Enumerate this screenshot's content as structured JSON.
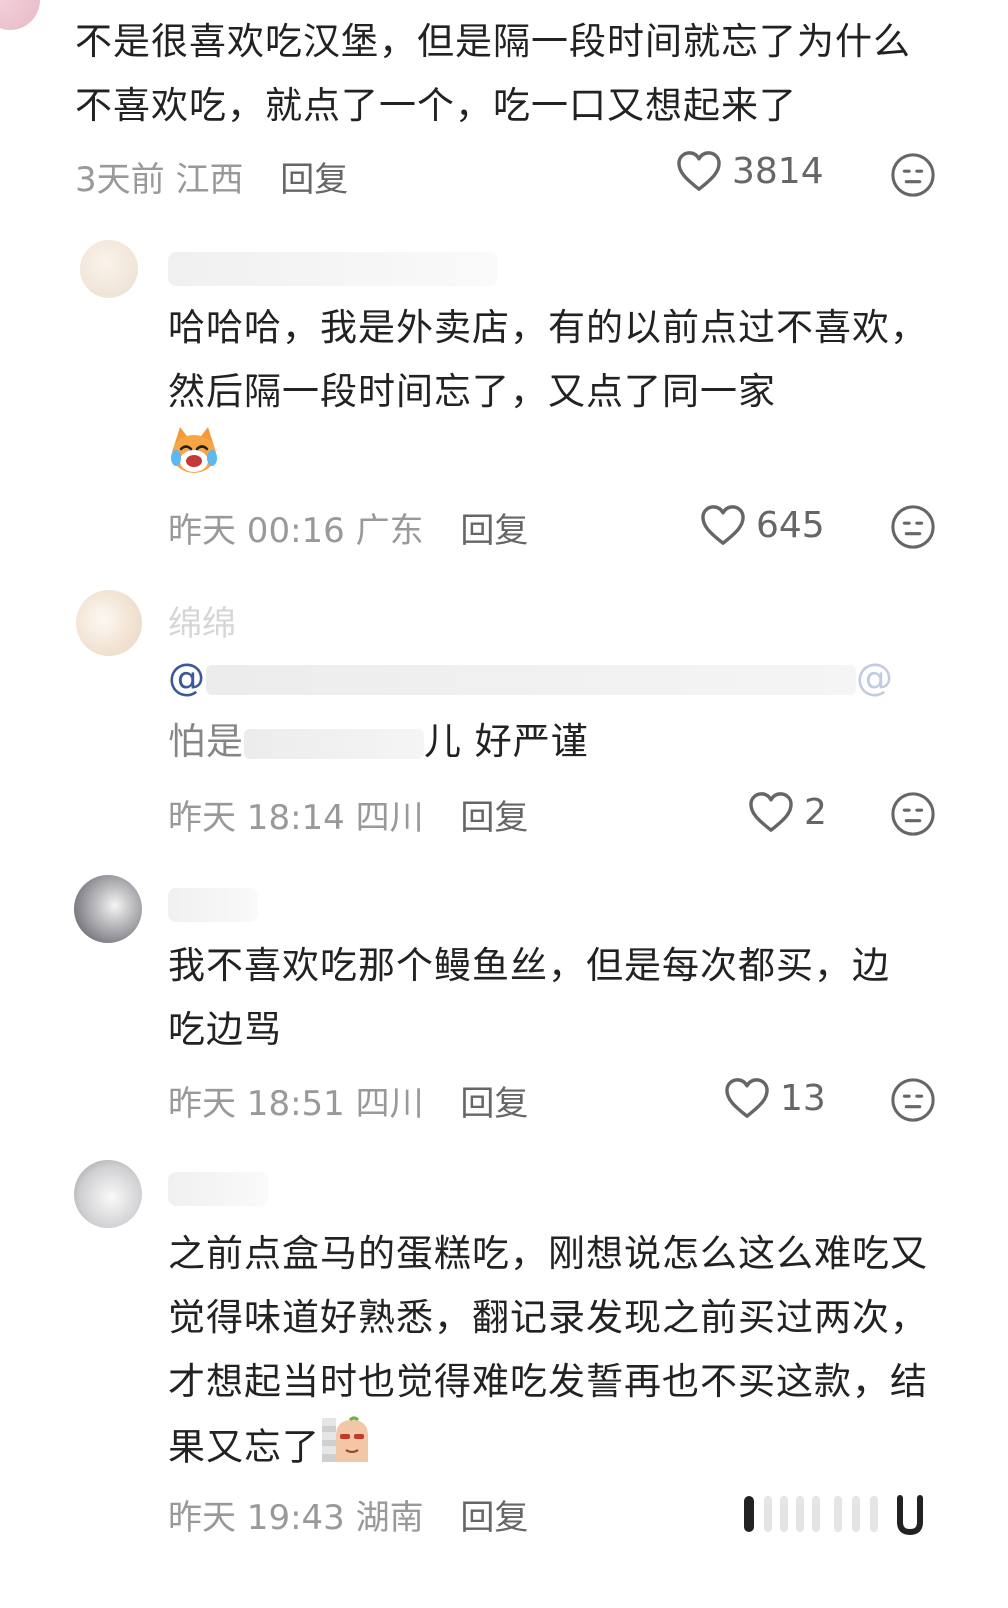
{
  "comments": [
    {
      "text": "不是很喜欢吃汉堡，但是隔一段时间就忘了为什么不喜欢吃，就点了一个，吃一口又想起来了",
      "time": "3天前",
      "location": "江西",
      "reply": "回复",
      "likes": "3814"
    },
    {
      "text": "哈哈哈，我是外卖店，有的以前点过不喜欢，然后隔一段时间忘了，又点了同一家",
      "emoji": "laughing-cat-emoji",
      "time": "昨天 00:16",
      "location": "广东",
      "reply": "回复",
      "likes": "645"
    },
    {
      "name": "绵绵",
      "mention_at": "@",
      "mention_at_end": "@",
      "text_visible_start": "怕是",
      "text_visible_end": "儿 好严谨",
      "time": "昨天 18:14",
      "location": "四川",
      "reply": "回复",
      "likes": "2"
    },
    {
      "text": "我不喜欢吃那个鳗鱼丝，但是每次都买，边吃边骂",
      "time": "昨天 18:51",
      "location": "四川",
      "reply": "回复",
      "likes": "13"
    },
    {
      "text": "之前点盒马的蛋糕吃，刚想说怎么这么难吃又觉得味道好熟悉，翻记录发现之前买过两次，才想起当时也觉得难吃发誓再也不买这款，结果又忘了",
      "sticker": "peeking-sticker",
      "time": "昨天 19:43",
      "location": "湖南",
      "reply": "回复"
    }
  ],
  "colors": {
    "text": "#222222",
    "meta": "#999999",
    "like": "#666666"
  }
}
